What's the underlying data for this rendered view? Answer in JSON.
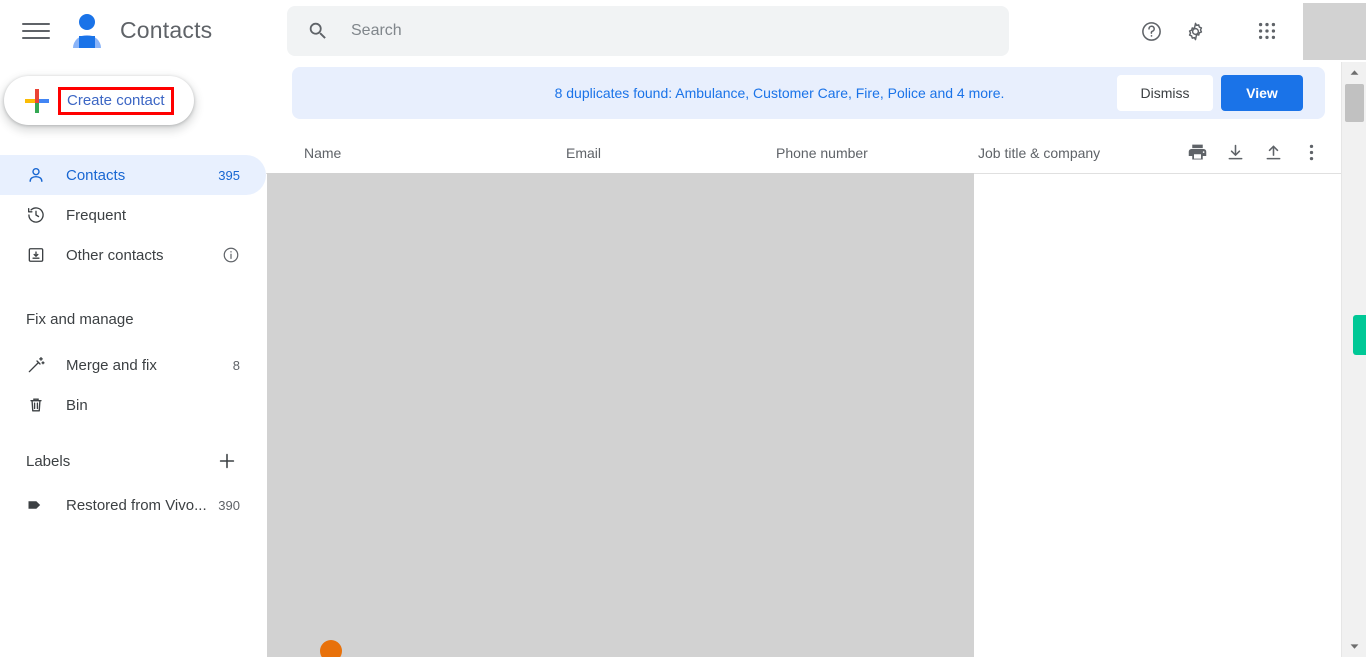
{
  "app": {
    "title": "Contacts",
    "colors": {
      "accent_blue": "#1a73e8",
      "active_bg": "#e8f0fe",
      "banner_bg": "#e8effd",
      "highlight_red": "#ff0000",
      "scroll_marker_green": "#00c896"
    }
  },
  "topbar": {
    "menu_icon": "hamburger-menu-icon",
    "logo_icon": "contacts-person-logo",
    "search": {
      "placeholder": "Search",
      "value": "",
      "icon": "search-icon"
    },
    "icons": [
      {
        "name": "help-icon",
        "label": "Support"
      },
      {
        "name": "settings-gear-icon",
        "label": "Settings"
      },
      {
        "name": "google-apps-grid-icon",
        "label": "Google apps"
      }
    ],
    "avatar": {
      "name": "account-avatar",
      "label": ""
    }
  },
  "sidebar": {
    "create_button": {
      "label": "Create contact",
      "icon": "plus-icon",
      "highlighted": true
    },
    "nav_items": [
      {
        "label": "Contacts",
        "count": "395",
        "icon": "person-outline-icon",
        "active": true
      },
      {
        "label": "Frequent",
        "count": "",
        "icon": "history-clock-icon",
        "active": false
      },
      {
        "label": "Other contacts",
        "count": "",
        "icon": "archive-box-icon",
        "active": false,
        "trailing_icon": "info-icon"
      }
    ],
    "fix_section": {
      "title": "Fix and manage",
      "items": [
        {
          "label": "Merge and fix",
          "count": "8",
          "icon": "magic-wand-icon"
        },
        {
          "label": "Bin",
          "count": "",
          "icon": "trash-bin-icon"
        }
      ]
    },
    "labels_section": {
      "title": "Labels",
      "add_icon": "plus-add-label-icon",
      "items": [
        {
          "label": "Restored from Vivo...",
          "count": "390",
          "icon": "label-tag-icon"
        }
      ]
    }
  },
  "main": {
    "banner": {
      "message": "8 duplicates found: Ambulance, Customer Care, Fire, Police and 4 more.",
      "dismiss_label": "Dismiss",
      "view_label": "View"
    },
    "table": {
      "columns": [
        "Name",
        "Email",
        "Phone number",
        "Job title & company"
      ],
      "actions": [
        {
          "name": "print-icon",
          "label": "Print"
        },
        {
          "name": "download-export-icon",
          "label": "Export"
        },
        {
          "name": "upload-import-icon",
          "label": "Import"
        },
        {
          "name": "more-options-icon",
          "label": "More options"
        }
      ],
      "rows": []
    }
  },
  "scrollbar": {
    "up_arrow": "scroll-up-arrow-icon",
    "down_arrow": "scroll-down-arrow-icon",
    "thumb": "scroll-thumb",
    "marker": "scroll-position-marker"
  }
}
